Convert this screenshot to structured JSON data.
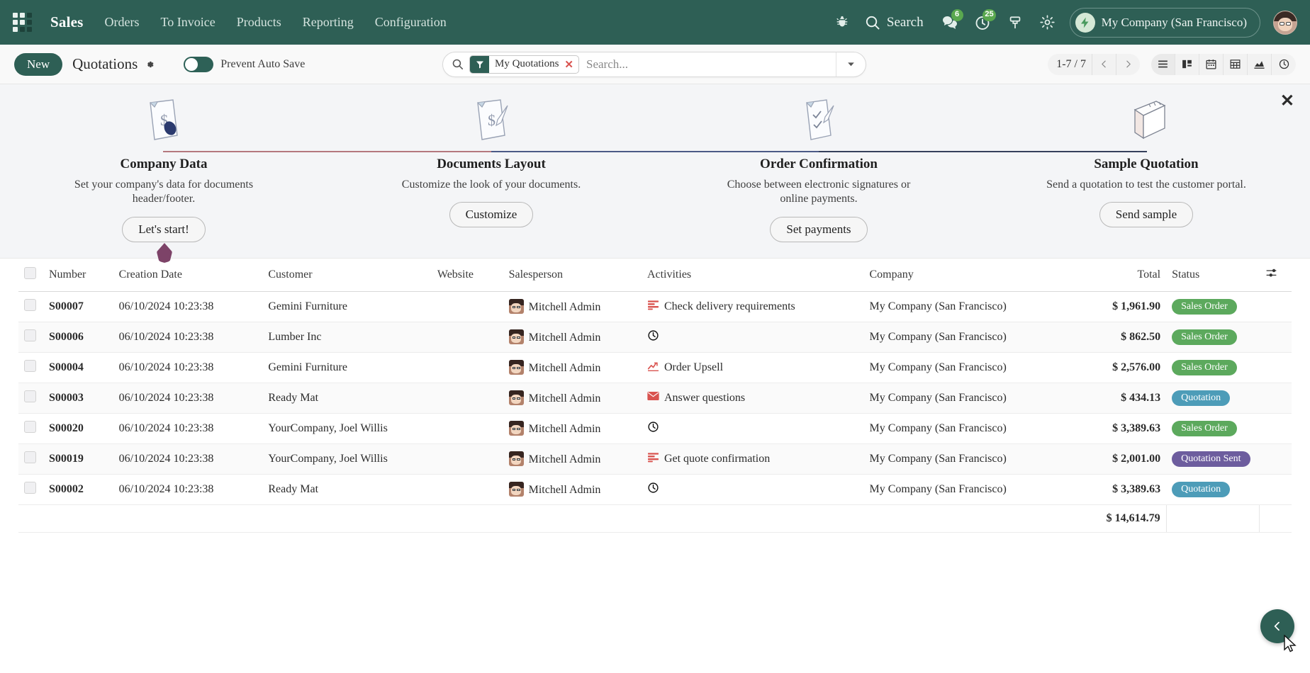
{
  "navbar": {
    "apps_icon": "apps-grid-icon",
    "brand": "Sales",
    "menu": [
      {
        "label": "Orders"
      },
      {
        "label": "To Invoice"
      },
      {
        "label": "Products"
      },
      {
        "label": "Reporting"
      },
      {
        "label": "Configuration"
      }
    ],
    "bug_icon": "bug-icon",
    "search_label": "Search",
    "messages_badge": "6",
    "activities_badge": "25",
    "company_name": "My Company (San Francisco)",
    "accent_color": "#2e5f55",
    "badge_color": "#5aa84f"
  },
  "control_panel": {
    "new_label": "New",
    "title": "Quotations",
    "autosave_label": "Prevent Auto Save",
    "autosave_on": true,
    "search": {
      "facet_label": "My Quotations",
      "facet_remove": "✕",
      "placeholder": "Search..."
    },
    "pager": "1-7 / 7",
    "views": [
      {
        "name": "list-view-icon",
        "active": true
      },
      {
        "name": "kanban-view-icon",
        "active": false
      },
      {
        "name": "calendar-view-icon",
        "active": false
      },
      {
        "name": "pivot-view-icon",
        "active": false
      },
      {
        "name": "graph-view-icon",
        "active": false
      },
      {
        "name": "activity-view-icon",
        "active": false
      }
    ]
  },
  "onboarding": {
    "close": "✕",
    "connector_colors": [
      "#b5787e",
      "#4b5a86",
      "#36405c"
    ],
    "steps": [
      {
        "title": "Company Data",
        "desc": "Set your company's data for documents header/footer.",
        "button": "Let's start!",
        "art": "document-dollar-icon"
      },
      {
        "title": "Documents Layout",
        "desc": "Customize the look of your documents.",
        "button": "Customize",
        "art": "document-layout-icon"
      },
      {
        "title": "Order Confirmation",
        "desc": "Choose between electronic signatures or online payments.",
        "button": "Set payments",
        "art": "document-check-icon"
      },
      {
        "title": "Sample Quotation",
        "desc": "Send a quotation to test the customer portal.",
        "button": "Send sample",
        "art": "envelope-box-icon"
      }
    ]
  },
  "list": {
    "columns": [
      "Number",
      "Creation Date",
      "Customer",
      "Website",
      "Salesperson",
      "Activities",
      "Company",
      "Total",
      "Status"
    ],
    "settings_icon": "column-settings-icon",
    "rows": [
      {
        "number": "S00007",
        "creation_date": "06/10/2024 10:23:38",
        "customer": "Gemini Furniture",
        "website": "",
        "salesperson": "Mitchell Admin",
        "activity": "Check delivery requirements",
        "activity_icon": "tasks-icon",
        "company": "My Company (San Francisco)",
        "total": "$ 1,961.90",
        "total_highlight": true,
        "status": "Sales Order",
        "status_color": "#5ca95d"
      },
      {
        "number": "S00006",
        "creation_date": "06/10/2024 10:23:38",
        "customer": "Lumber Inc",
        "website": "",
        "salesperson": "Mitchell Admin",
        "activity": "",
        "activity_icon": "clock-icon",
        "company": "My Company (San Francisco)",
        "total": "$ 862.50",
        "total_highlight": false,
        "status": "Sales Order",
        "status_color": "#5ca95d"
      },
      {
        "number": "S00004",
        "creation_date": "06/10/2024 10:23:38",
        "customer": "Gemini Furniture",
        "website": "",
        "salesperson": "Mitchell Admin",
        "activity": "Order Upsell",
        "activity_icon": "chart-line-icon",
        "company": "My Company (San Francisco)",
        "total": "$ 2,576.00",
        "total_highlight": false,
        "status": "Sales Order",
        "status_color": "#5ca95d"
      },
      {
        "number": "S00003",
        "creation_date": "06/10/2024 10:23:38",
        "customer": "Ready Mat",
        "website": "",
        "salesperson": "Mitchell Admin",
        "activity": "Answer questions",
        "activity_icon": "envelope-icon",
        "company": "My Company (San Francisco)",
        "total": "$ 434.13",
        "total_highlight": false,
        "status": "Quotation",
        "status_color": "#4d9cb8"
      },
      {
        "number": "S00020",
        "creation_date": "06/10/2024 10:23:38",
        "customer": "YourCompany, Joel Willis",
        "website": "",
        "salesperson": "Mitchell Admin",
        "activity": "",
        "activity_icon": "clock-icon",
        "company": "My Company (San Francisco)",
        "total": "$ 3,389.63",
        "total_highlight": false,
        "status": "Sales Order",
        "status_color": "#5ca95d"
      },
      {
        "number": "S00019",
        "creation_date": "06/10/2024 10:23:38",
        "customer": "YourCompany, Joel Willis",
        "website": "",
        "salesperson": "Mitchell Admin",
        "activity": "Get quote confirmation",
        "activity_icon": "tasks-icon",
        "company": "My Company (San Francisco)",
        "total": "$ 2,001.00",
        "total_highlight": false,
        "status": "Quotation Sent",
        "status_color": "#6d5d9e"
      },
      {
        "number": "S00002",
        "creation_date": "06/10/2024 10:23:38",
        "customer": "Ready Mat",
        "website": "",
        "salesperson": "Mitchell Admin",
        "activity": "",
        "activity_icon": "clock-icon",
        "company": "My Company (San Francisco)",
        "total": "$ 3,389.63",
        "total_highlight": false,
        "status": "Quotation",
        "status_color": "#4d9cb8"
      }
    ],
    "grand_total": "$ 14,614.79"
  },
  "fab": {
    "icon": "chevron-left-icon"
  }
}
